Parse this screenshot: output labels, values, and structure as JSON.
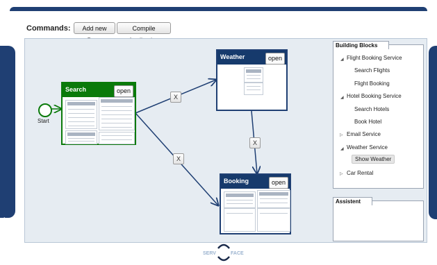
{
  "commands": {
    "label": "Commands:",
    "add_page": "Add new Page",
    "compile": "Compile Application"
  },
  "canvas": {
    "start_label": "Start",
    "pages": [
      {
        "title": "Search",
        "open_label": "open",
        "color": "#0a7a0a"
      },
      {
        "title": "Weather",
        "open_label": "open",
        "color": "#163a6c"
      },
      {
        "title": "Booking",
        "open_label": "open",
        "color": "#163a6c"
      }
    ],
    "connector_label": "X"
  },
  "building_blocks": {
    "title": "Building Blocks",
    "items": [
      {
        "label": "Flight Booking Service",
        "type": "group",
        "expanded": true
      },
      {
        "label": "Search Flights",
        "type": "leaf"
      },
      {
        "label": "Flight Booking",
        "type": "leaf"
      },
      {
        "label": "Hotel Booking Service",
        "type": "group",
        "expanded": true
      },
      {
        "label": "Search Hotels",
        "type": "leaf"
      },
      {
        "label": "Book Hotel",
        "type": "leaf"
      },
      {
        "label": "Email Service",
        "type": "group",
        "expanded": false
      },
      {
        "label": "Weather Service",
        "type": "group",
        "expanded": true
      },
      {
        "label": "Show Weather",
        "type": "leaf",
        "selected": true
      },
      {
        "label": "Car Rental",
        "type": "group",
        "expanded": false
      }
    ]
  },
  "assistant": {
    "title": "Assistent"
  },
  "sidebar": {
    "expand_glyph": "›"
  },
  "logo": {
    "left": "SERV",
    "right": "FACE"
  }
}
